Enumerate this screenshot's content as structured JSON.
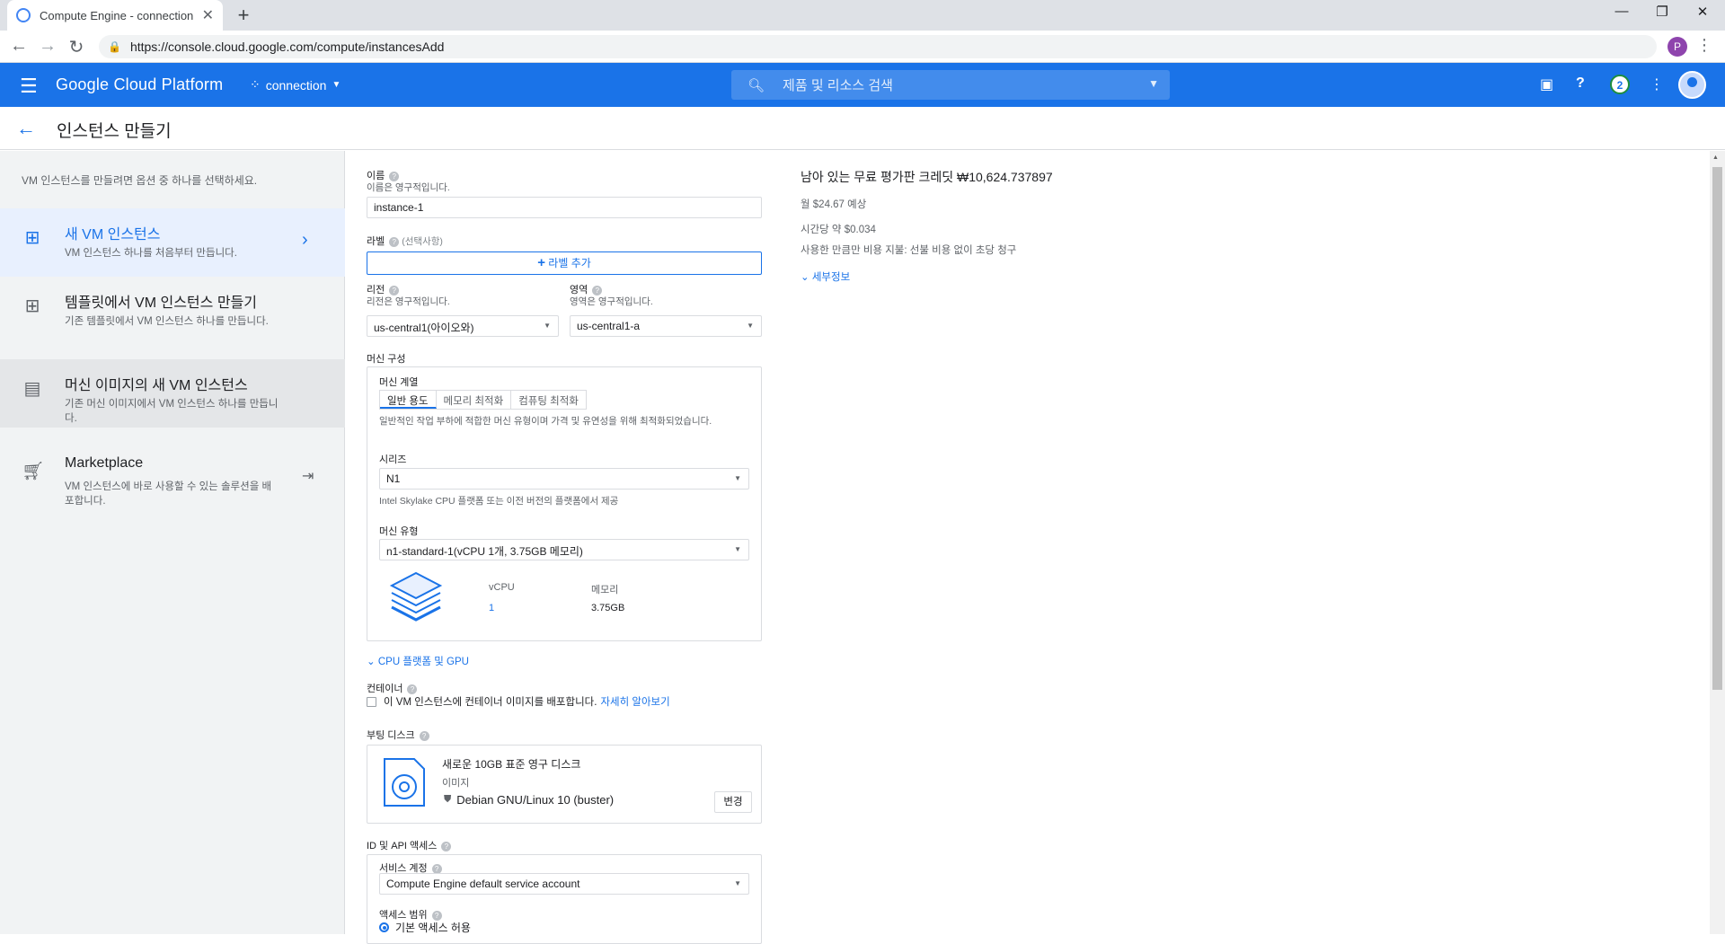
{
  "browser": {
    "tab_title": "Compute Engine - connection -",
    "url": "https://console.cloud.google.com/compute/instancesAdd",
    "profile_initial": "P"
  },
  "header": {
    "brand": "Google Cloud Platform",
    "project": "connection",
    "search_placeholder": "제품 및 리소스 검색",
    "notification_count": "2"
  },
  "page": {
    "title": "인스턴스 만들기"
  },
  "left_panel": {
    "intro": "VM 인스턴스를 만들려면 옵션 중 하나를 선택하세요.",
    "options": [
      {
        "title": "새 VM 인스턴스",
        "desc": "VM 인스턴스 하나를 처음부터 만듭니다."
      },
      {
        "title": "템플릿에서 VM 인스턴스 만들기",
        "desc": "기존 템플릿에서 VM 인스턴스 하나를 만듭니다."
      },
      {
        "title": "머신 이미지의 새 VM 인스턴스",
        "desc": "기존 머신 이미지에서 VM 인스턴스 하나를 만듭니다."
      },
      {
        "title": "Marketplace",
        "desc": "VM 인스턴스에 바로 사용할 수 있는 솔루션을 배포합니다."
      }
    ]
  },
  "form": {
    "name_label": "이름",
    "name_sub": "이름은 영구적입니다.",
    "name_value": "instance-1",
    "labels_label": "라벨",
    "labels_optional": "(선택사항)",
    "add_label_button": "라벨 추가",
    "region_label": "리전",
    "region_sub": "리전은 영구적입니다.",
    "region_value": "us-central1(아이오와)",
    "zone_label": "영역",
    "zone_sub": "영역은 영구적입니다.",
    "zone_value": "us-central1-a",
    "machine_config_label": "머신 구성",
    "machine_family_label": "머신 계열",
    "family_tabs": [
      "일반 용도",
      "메모리 최적화",
      "컴퓨팅 최적화"
    ],
    "family_desc": "일반적인 작업 부하에 적합한 머신 유형이며 가격 및 유연성을 위해 최적화되었습니다.",
    "series_label": "시리즈",
    "series_value": "N1",
    "series_desc": "Intel Skylake CPU 플랫폼 또는 이전 버전의 플랫폼에서 제공",
    "machine_type_label": "머신 유형",
    "machine_type_value": "n1-standard-1(vCPU 1개, 3.75GB 메모리)",
    "vcpu_header": "vCPU",
    "vcpu_value": "1",
    "memory_header": "메모리",
    "memory_value": "3.75GB",
    "cpu_gpu_link": "CPU 플랫폼 및 GPU",
    "container_label": "컨테이너",
    "container_checkbox": "이 VM 인스턴스에 컨테이너 이미지를 배포합니다.",
    "container_link": "자세히 알아보기",
    "boot_disk_label": "부팅 디스크",
    "boot_disk_title": "새로운 10GB 표준 영구 디스크",
    "boot_disk_image_label": "이미지",
    "boot_disk_image": "Debian GNU/Linux 10 (buster)",
    "change_button": "변경",
    "api_access_label": "ID 및 API 액세스",
    "service_account_label": "서비스 계정",
    "service_account_value": "Compute Engine default service account",
    "access_scope_label": "액세스 범위",
    "access_scope_option": "기본 액세스 허용"
  },
  "pricing": {
    "credit": "남아 있는 무료 평가판 크레딧 ₩10,624.737897",
    "monthly": "월 $24.67 예상",
    "hourly": "시간당 약 $0.034",
    "billing_note": "사용한 만큼만 비용 지불: 선불 비용 없이 초당 청구",
    "details_link": "세부정보"
  }
}
